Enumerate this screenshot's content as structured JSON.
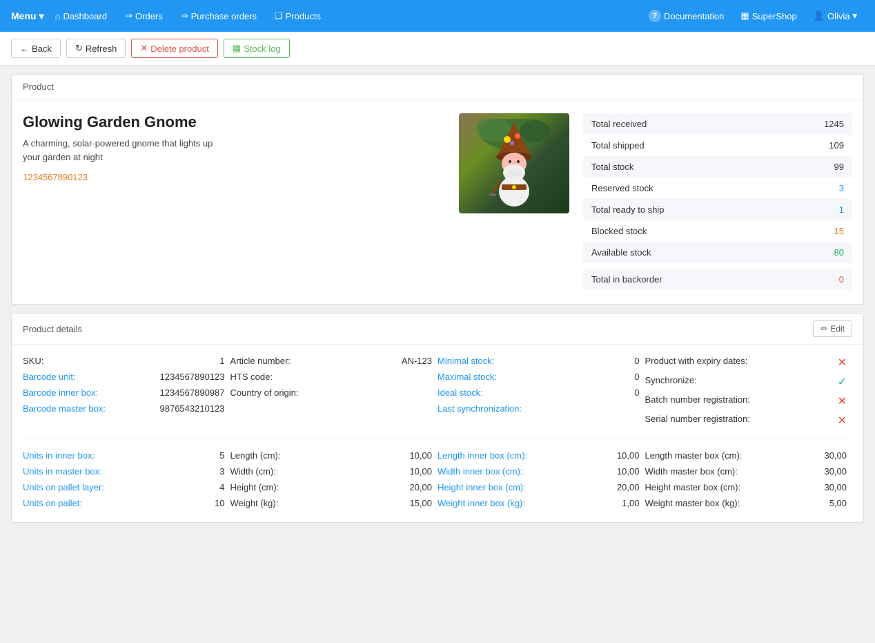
{
  "nav": {
    "menu_label": "Menu",
    "dashboard_label": "Dashboard",
    "orders_label": "Orders",
    "purchase_orders_label": "Purchase orders",
    "products_label": "Products",
    "documentation_label": "Documentation",
    "shop_label": "SuperShop",
    "user_label": "Olivia"
  },
  "toolbar": {
    "back_label": "Back",
    "refresh_label": "Refresh",
    "delete_label": "Delete product",
    "stock_log_label": "Stock log"
  },
  "product_section": {
    "section_title": "Product",
    "product_name": "Glowing Garden Gnome",
    "product_desc_line1": "A charming, solar-powered gnome that lights up",
    "product_desc_line2": "your garden at night",
    "product_barcode": "1234567890123",
    "stats": [
      {
        "label": "Total received",
        "value": "1245",
        "color": "plain"
      },
      {
        "label": "Total shipped",
        "value": "109",
        "color": "plain"
      },
      {
        "label": "Total stock",
        "value": "99",
        "color": "plain"
      },
      {
        "label": "Reserved stock",
        "value": "3",
        "color": "blue"
      },
      {
        "label": "Total ready to ship",
        "value": "1",
        "color": "blue"
      },
      {
        "label": "Blocked stock",
        "value": "15",
        "color": "orange"
      },
      {
        "label": "Available stock",
        "value": "80",
        "color": "green"
      },
      {
        "label": "Total in backorder",
        "value": "0",
        "color": "red"
      }
    ]
  },
  "product_details": {
    "section_title": "Product details",
    "edit_label": "Edit",
    "fields_col1": [
      {
        "label": "SKU:",
        "value": "1",
        "label_color": "black"
      },
      {
        "label": "Barcode unit:",
        "value": "1234567890123",
        "label_color": "blue"
      },
      {
        "label": "Barcode inner box:",
        "value": "1234567890987",
        "label_color": "blue"
      },
      {
        "label": "Barcode master box:",
        "value": "9876543210123",
        "label_color": "blue"
      }
    ],
    "fields_col2": [
      {
        "label": "Article number:",
        "value": "AN-123",
        "label_color": "black"
      },
      {
        "label": "HTS code:",
        "value": "",
        "label_color": "black"
      },
      {
        "label": "Country of origin:",
        "value": "",
        "label_color": "black"
      },
      {
        "label": "",
        "value": "",
        "label_color": "black"
      }
    ],
    "fields_col3": [
      {
        "label": "Minimal stock:",
        "value": "0",
        "label_color": "blue"
      },
      {
        "label": "Maximal stock:",
        "value": "0",
        "label_color": "blue"
      },
      {
        "label": "Ideal stock:",
        "value": "0",
        "label_color": "blue"
      },
      {
        "label": "Last synchronization:",
        "value": "",
        "label_color": "blue"
      }
    ],
    "fields_col4": [
      {
        "label": "Product with expiry dates:",
        "value": "✗",
        "label_color": "black",
        "value_color": "cross"
      },
      {
        "label": "Synchronize:",
        "value": "✓",
        "label_color": "black",
        "value_color": "check"
      },
      {
        "label": "Batch number registration:",
        "value": "✗",
        "label_color": "black",
        "value_color": "cross"
      },
      {
        "label": "Serial number registration:",
        "value": "✗",
        "label_color": "black",
        "value_color": "cross"
      }
    ],
    "fields2_col1": [
      {
        "label": "Units in inner box:",
        "value": "5",
        "label_color": "blue"
      },
      {
        "label": "Units in master box:",
        "value": "3",
        "label_color": "blue"
      },
      {
        "label": "Units on pallet layer:",
        "value": "4",
        "label_color": "blue"
      },
      {
        "label": "Units on pallet:",
        "value": "10",
        "label_color": "blue"
      }
    ],
    "fields2_col2": [
      {
        "label": "Length (cm):",
        "value": "10,00",
        "label_color": "black"
      },
      {
        "label": "Width (cm):",
        "value": "10,00",
        "label_color": "black"
      },
      {
        "label": "Height (cm):",
        "value": "20,00",
        "label_color": "black"
      },
      {
        "label": "Weight (kg):",
        "value": "15,00",
        "label_color": "black"
      }
    ],
    "fields2_col3": [
      {
        "label": "Length inner box (cm):",
        "value": "10,00",
        "label_color": "blue"
      },
      {
        "label": "Width inner box (cm):",
        "value": "10,00",
        "label_color": "blue"
      },
      {
        "label": "Height inner box (cm):",
        "value": "20,00",
        "label_color": "blue"
      },
      {
        "label": "Weight inner box (kg):",
        "value": "1,00",
        "label_color": "blue"
      }
    ],
    "fields2_col4": [
      {
        "label": "Length master box (cm):",
        "value": "30,00",
        "label_color": "black"
      },
      {
        "label": "Width master box (cm):",
        "value": "30,00",
        "label_color": "black"
      },
      {
        "label": "Height master box (cm):",
        "value": "30,00",
        "label_color": "black"
      },
      {
        "label": "Weight master box (kg):",
        "value": "5,00",
        "label_color": "black"
      }
    ]
  }
}
